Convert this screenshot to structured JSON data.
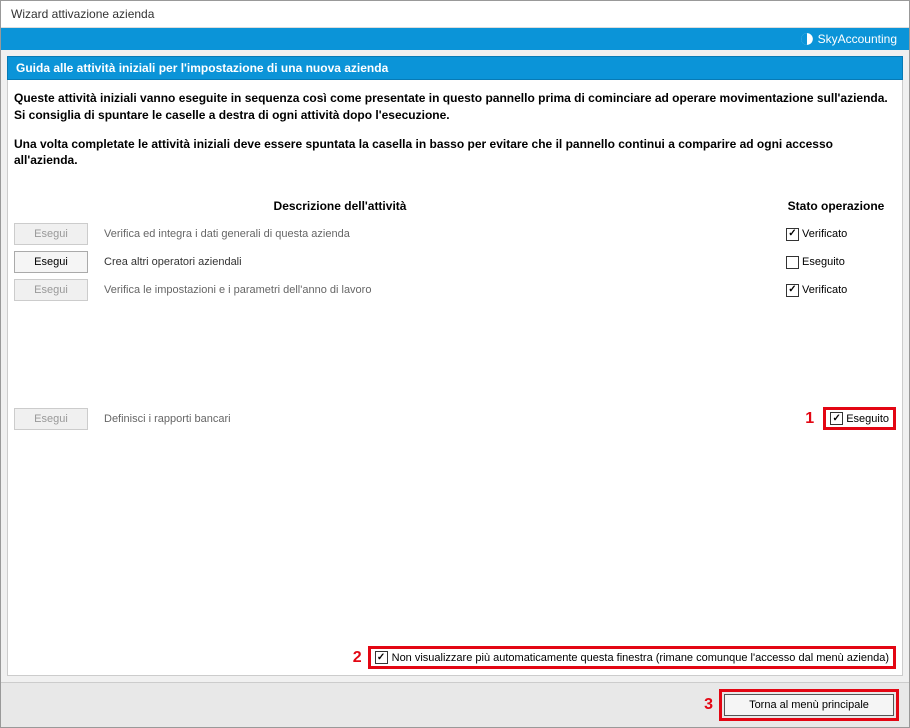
{
  "titlebar": "Wizard attivazione azienda",
  "brand": "SkyAccounting",
  "guide_header": "Guida alle attività iniziali per l'impostazione di una nuova azienda",
  "intro_p1": "Queste attività iniziali vanno eseguite in sequenza così come presentate in questo pannello prima di cominciare ad operare movimentazione sull'azienda. Si consiglia di spuntare le caselle a destra di ogni attività dopo l'esecuzione.",
  "intro_p2": "Una volta completate le attività iniziali deve essere spuntata la casella in basso per evitare che il pannello continui a comparire ad ogni accesso all'azienda.",
  "columns": {
    "desc": "Descrizione dell'attività",
    "status": "Stato operazione"
  },
  "exec_label": "Esegui",
  "activities": [
    {
      "desc": "Verifica ed integra i dati generali di questa azienda",
      "status_label": "Verificato",
      "checked": true,
      "enabled": false
    },
    {
      "desc": "Crea altri operatori aziendali",
      "status_label": "Eseguito",
      "checked": false,
      "enabled": true
    },
    {
      "desc": "Verifica le impostazioni e i parametri dell'anno di lavoro",
      "status_label": "Verificato",
      "checked": true,
      "enabled": false
    }
  ],
  "activity_bank": {
    "desc": "Definisci i rapporti bancari",
    "status_label": "Eseguito",
    "checked": true,
    "enabled": false
  },
  "annotations": {
    "a1": "1",
    "a2": "2",
    "a3": "3"
  },
  "hide_window_label": "Non visualizzare più automaticamente questa finestra (rimane comunque l'accesso dal menù azienda)",
  "hide_window_checked": true,
  "footer_button": "Torna al menù principale"
}
